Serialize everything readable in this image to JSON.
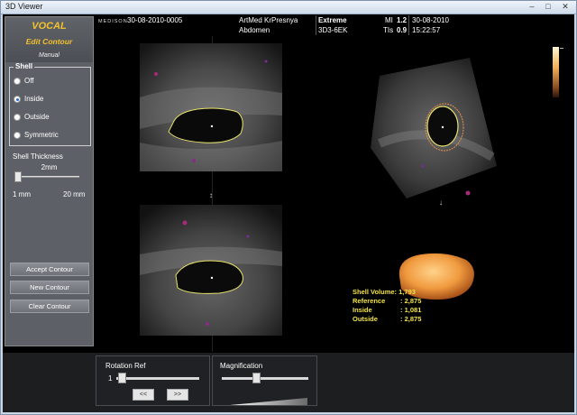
{
  "window": {
    "title": "3D Viewer"
  },
  "panel": {
    "title": "VOCAL",
    "subtitle": "Edit Contour",
    "mode": "Manual",
    "shell": {
      "group_label": "Shell",
      "options": [
        {
          "label": "Off",
          "selected": false
        },
        {
          "label": "Inside",
          "selected": true
        },
        {
          "label": "Outside",
          "selected": false
        },
        {
          "label": "Symmetric",
          "selected": false
        }
      ]
    },
    "thickness": {
      "label": "Shell Thickness",
      "value": "2mm",
      "min_label": "1 mm",
      "max_label": "20 mm",
      "slider_value": 0.0
    },
    "buttons": [
      "Accept Contour",
      "New Contour",
      "Clear Contour"
    ]
  },
  "header": {
    "logo": "MEDISON",
    "date_id": "30-08-2010-0005",
    "site": "ArtMed KrPresnya",
    "exam": "Abdomen",
    "preset": "Extreme",
    "probe": "3D3-6EK",
    "mi_label": "MI",
    "mi_value": "1.2",
    "tis_label": "TIs",
    "tis_value": "0.9",
    "date": "30-08-2010",
    "time": "15:22:57"
  },
  "volume": {
    "lines": [
      {
        "label": "Shell Volume",
        "value": "1,793"
      },
      {
        "label": "Reference",
        "value": "2,875"
      },
      {
        "label": "Inside",
        "value": "1,081"
      },
      {
        "label": "Outside",
        "value": "2,875"
      }
    ]
  },
  "bottom": {
    "rotation": {
      "label": "Rotation Ref",
      "value": "1",
      "prev": "<<",
      "next": ">>"
    },
    "magnification": {
      "label": "Magnification"
    }
  },
  "colors": {
    "accent": "#f2c12e",
    "contour": "#e8e36a",
    "render": "#f0a040"
  }
}
